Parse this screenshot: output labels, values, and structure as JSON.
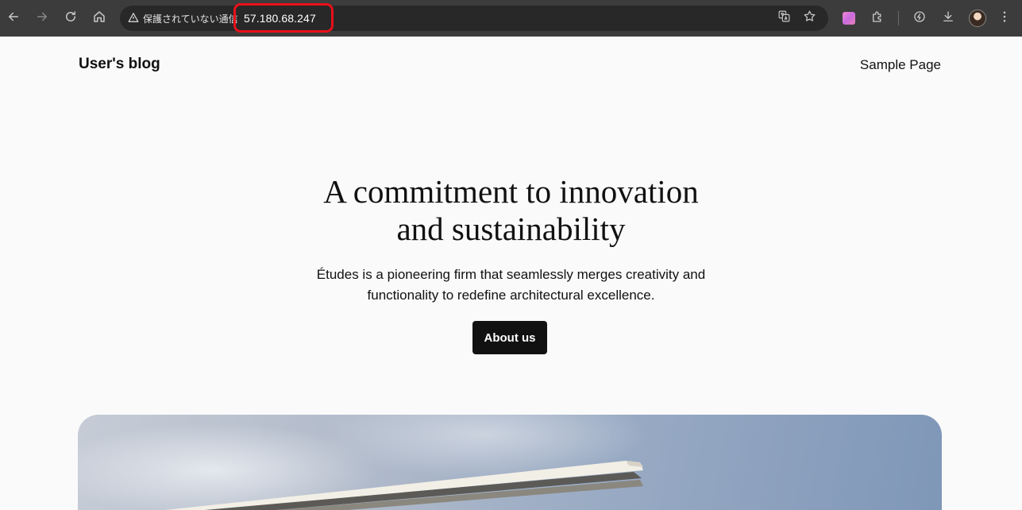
{
  "browser": {
    "security_label": "保護されていない通信",
    "url": "57.180.68.247",
    "icons": {
      "back": "back-arrow-icon",
      "forward": "forward-arrow-icon",
      "reload": "reload-icon",
      "home": "home-icon",
      "warning": "warning-triangle-icon",
      "translate": "translate-icon",
      "bookmark": "star-icon",
      "extension": "extension-app-icon",
      "extensions_menu": "puzzle-icon",
      "performance": "performance-icon",
      "download": "download-icon",
      "profile": "avatar",
      "menu": "kebab-menu-icon"
    },
    "highlight_color": "#e8101a"
  },
  "site": {
    "title": "User's blog",
    "nav": [
      {
        "label": "Sample Page"
      }
    ]
  },
  "hero": {
    "title_line1": "A commitment to innovation",
    "title_line2": "and sustainability",
    "subtitle_line1": "Études is a pioneering firm that seamlessly merges creativity and",
    "subtitle_line2": "functionality to redefine architectural excellence.",
    "button_label": "About us"
  },
  "colors": {
    "page_background": "#fafafa",
    "text": "#111111",
    "button_background": "#111111",
    "button_text": "#ffffff",
    "chrome_background": "#3c3c3c"
  }
}
